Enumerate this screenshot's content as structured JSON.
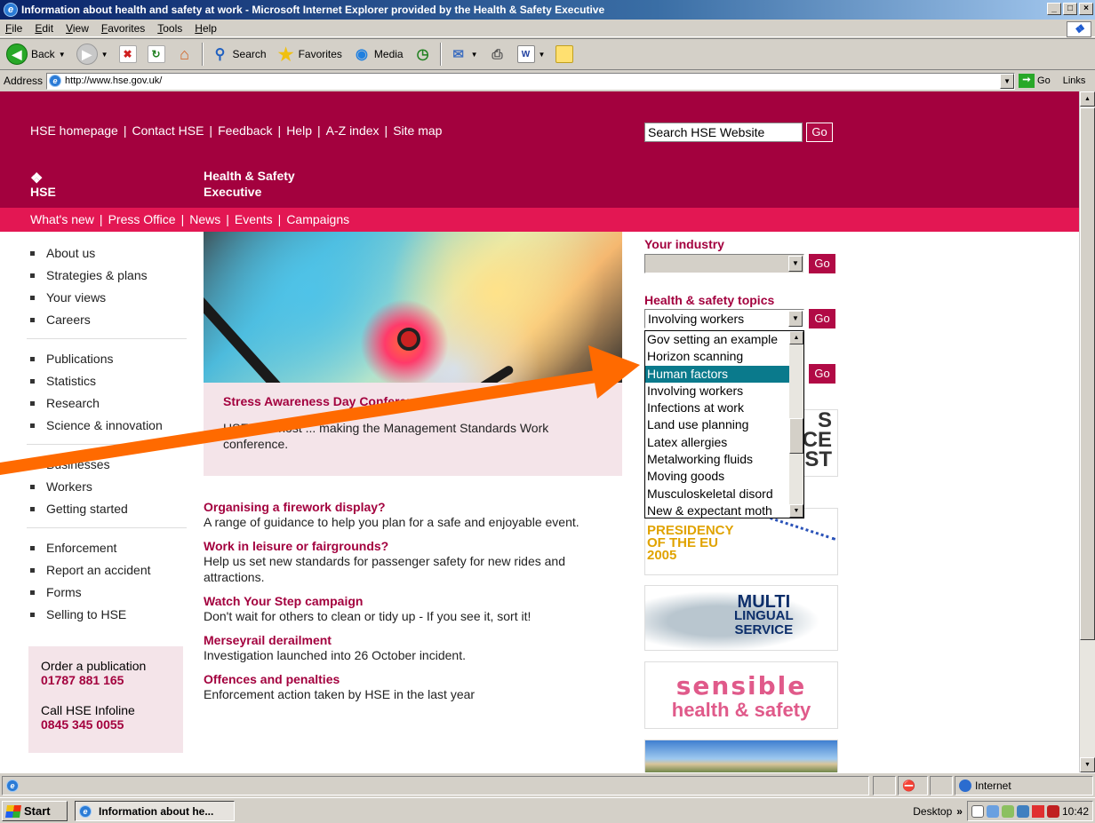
{
  "window": {
    "title": "Information about health and safety at work - Microsoft Internet Explorer provided by the Health & Safety Executive",
    "btn_min": "_",
    "btn_max": "□",
    "btn_close": "×"
  },
  "menu": [
    "File",
    "Edit",
    "View",
    "Favorites",
    "Tools",
    "Help"
  ],
  "toolbar": {
    "back": "Back",
    "search": "Search",
    "favorites": "Favorites",
    "media": "Media"
  },
  "address": {
    "label": "Address",
    "url": "http://www.hse.gov.uk/",
    "go": "Go",
    "links": "Links"
  },
  "topnav": [
    "HSE homepage",
    "Contact HSE",
    "Feedback",
    "Help",
    "A-Z index",
    "Site map"
  ],
  "search": {
    "placeholder": "Search HSE Website",
    "go": "Go"
  },
  "logo": {
    "text": "HSE"
  },
  "org_name": [
    "Health & Safety",
    "Executive"
  ],
  "subnav": [
    "What's new",
    "Press Office",
    "News",
    "Events",
    "Campaigns"
  ],
  "leftnav": [
    [
      "About us",
      "Strategies & plans",
      "Your views",
      "Careers"
    ],
    [
      "Publications",
      "Statistics",
      "Research",
      "Science & innovation"
    ],
    [
      "Businesses",
      "Workers",
      "Getting started"
    ],
    [
      "Enforcement",
      "Report an accident",
      "Forms",
      "Selling to HSE"
    ]
  ],
  "contact": {
    "order_label": "Order a publication",
    "order_number": "01787 881 165",
    "infoline_label": "Call HSE Infoline",
    "infoline_number": "0845 345 0055"
  },
  "feature": {
    "title": "Stress Awareness Day Conference",
    "text": "HSE joint host ... making the Management Standards Work conference."
  },
  "news": [
    {
      "title": "Organising a firework display?",
      "text": "A range of guidance to help you plan for a safe and enjoyable event."
    },
    {
      "title": "Work in leisure or fairgrounds?",
      "text": "Help us set new standards for passenger safety for new rides and attractions."
    },
    {
      "title": "Watch Your Step campaign",
      "text": "Don't wait for others to clean or tidy up - If you see it, sort it!"
    },
    {
      "title": "Merseyrail derailment",
      "text": "Investigation launched into 26 October incident."
    },
    {
      "title": "Offences and penalties",
      "text": "Enforcement action taken by HSE in the last year"
    }
  ],
  "industry": {
    "label": "Your industry",
    "value": "",
    "go": "Go"
  },
  "topics": {
    "label": "Health & safety topics",
    "value": "Involving workers",
    "go": "Go",
    "options": [
      "Gov setting an example",
      "Horizon scanning",
      "Human factors",
      "Involving workers",
      "Infections at work",
      "Land use planning",
      "Latex allergies",
      "Metalworking fluids",
      "Moving goods",
      "Musculoskeletal disord",
      "New & expectant moth"
    ],
    "highlighted": "Human factors"
  },
  "third_go": "Go",
  "banners": {
    "b1": [
      "S",
      "CE",
      "ST"
    ],
    "b2": [
      "PRESIDENCY",
      "OF THE EU",
      "2005"
    ],
    "b3": [
      "MULTI",
      "LINGUAL",
      "SERVICE"
    ],
    "b4": [
      "sensible",
      "health & safety"
    ]
  },
  "status": {
    "zone": "Internet"
  },
  "taskbar": {
    "start": "Start",
    "task": "Information about he...",
    "desktop": "Desktop",
    "chevron": "»",
    "clock": "10:42"
  },
  "colors": {
    "brand": "#a3013e",
    "subnav": "#e31753",
    "arrow": "#ff6a00"
  }
}
